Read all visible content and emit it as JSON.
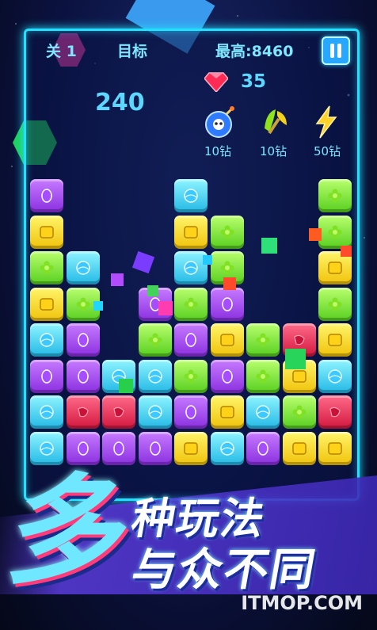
{
  "hud": {
    "level_text": "关 1",
    "target_text": "目标",
    "best_text": "最高:8460",
    "score": "240",
    "gems": "35"
  },
  "powerups": [
    {
      "name": "bomb",
      "cost": "10钻"
    },
    {
      "name": "hammer",
      "cost": "10钻"
    },
    {
      "name": "lightning",
      "cost": "50钻"
    }
  ],
  "banner": {
    "big_char": "多",
    "line1": "种玩法",
    "line2": "与众不同"
  },
  "watermark": "ITMOP.COM",
  "colors": {
    "frame": "#22e0ff",
    "hud_text": "#7fe6ff",
    "banner_bg": "#5a3cdc"
  },
  "board": [
    [
      "purple",
      "",
      "",
      "",
      "blue",
      "",
      "",
      "",
      "green"
    ],
    [
      "yellow",
      "",
      "",
      "",
      "yellow",
      "green",
      "",
      "",
      "green"
    ],
    [
      "green",
      "blue",
      "",
      "",
      "blue",
      "green",
      "",
      "",
      "yellow"
    ],
    [
      "yellow",
      "green",
      "",
      "purple",
      "green",
      "purple",
      "",
      "",
      "green"
    ],
    [
      "blue",
      "purple",
      "",
      "green",
      "purple",
      "yellow",
      "green",
      "red",
      "yellow"
    ],
    [
      "purple",
      "purple",
      "blue",
      "blue",
      "green",
      "purple",
      "green",
      "yellow",
      "blue"
    ],
    [
      "blue",
      "red",
      "red",
      "blue",
      "purple",
      "yellow",
      "blue",
      "green",
      "red"
    ],
    [
      "blue",
      "purple",
      "purple",
      "purple",
      "yellow",
      "blue",
      "purple",
      "yellow",
      "yellow"
    ]
  ]
}
